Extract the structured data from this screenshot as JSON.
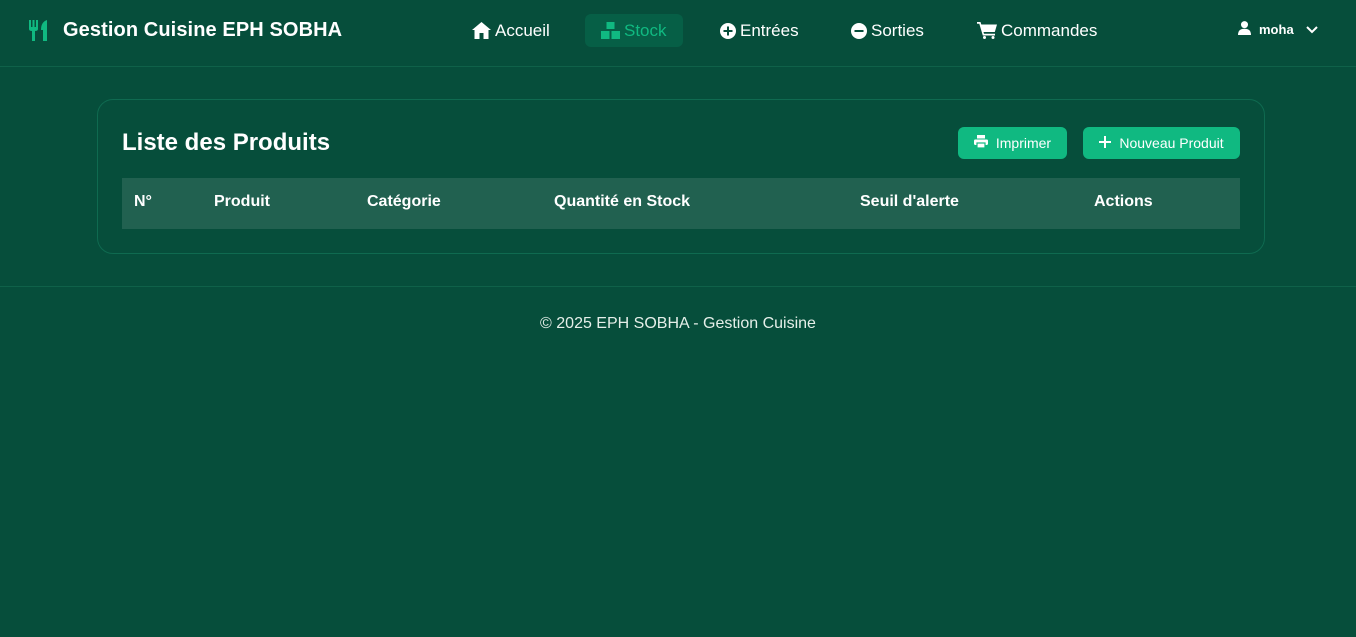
{
  "brand": {
    "title": "Gestion Cuisine EPH SOBHA",
    "icon": "utensils-icon"
  },
  "nav": {
    "items": [
      {
        "label": "Accueil",
        "icon": "home-icon",
        "active": false
      },
      {
        "label": "Stock",
        "icon": "boxes-icon",
        "active": true
      },
      {
        "label": "Entrées",
        "icon": "plus-circle-icon",
        "active": false
      },
      {
        "label": "Sorties",
        "icon": "minus-circle-icon",
        "active": false
      },
      {
        "label": "Commandes",
        "icon": "cart-icon",
        "active": false
      }
    ]
  },
  "user": {
    "name": "moha",
    "icon": "user-icon",
    "dropdown_icon": "chevron-down-icon"
  },
  "main": {
    "title": "Liste des Produits",
    "print_label": "Imprimer",
    "new_label": "Nouveau Produit",
    "columns": [
      "N°",
      "Produit",
      "Catégorie",
      "Quantité en Stock",
      "Seuil d'alerte",
      "Actions"
    ]
  },
  "footer": {
    "text": "© 2025 EPH SOBHA - Gestion Cuisine"
  },
  "colors": {
    "background": "#064e3b",
    "accent": "#10b981",
    "table_header": "#216150",
    "active_nav_bg": "#065f46"
  }
}
